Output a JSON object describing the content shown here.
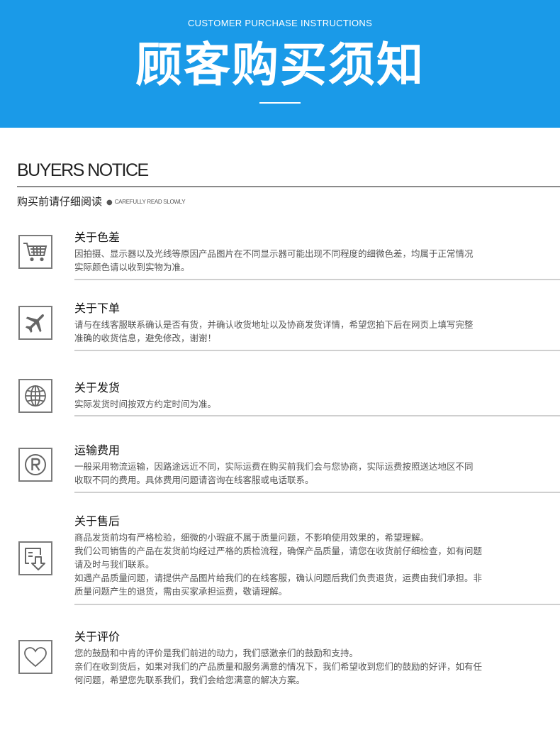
{
  "banner": {
    "title_en": "CUSTOMER PURCHASE INSTRUCTIONS",
    "title_cn": "顾客购买须知"
  },
  "notice": {
    "title": "BUYERS NOTICE",
    "subtitle_cn": "购买前请仔细阅读",
    "subtitle_dot": "●",
    "subtitle_en": "CAREFULLY READ SLOWLY"
  },
  "sections": [
    {
      "icon": "shopping-cart-icon",
      "title": "关于色差",
      "lines": [
        "因拍摄、显示器以及光线等原因产品图片在不同显示器可能出现不同程度的细微色差，均属于正常情况",
        "实际颜色请以收到实物为准。"
      ]
    },
    {
      "icon": "airplane-icon",
      "title": "关于下单",
      "lines": [
        "请与在线客服联系确认是否有货，并确认收货地址以及协商发货详情，希望您拍下后在网页上填写完整",
        "准确的收货信息，避免修改，谢谢！"
      ]
    },
    {
      "icon": "globe-icon",
      "title": "关于发货",
      "lines": [
        "实际发货时间按双方约定时间为准。"
      ]
    },
    {
      "icon": "registered-icon",
      "title": "运输费用",
      "lines": [
        "一般采用物流运输，因路途远近不同，实际运费在购买前我们会与您协商，实际运费按照送达地区不同",
        "收取不同的费用。具体费用问题请咨询在线客服或电话联系。"
      ]
    },
    {
      "icon": "return-download-icon",
      "title": "关于售后",
      "lines": [
        "商品发货前均有严格检验，细微的小瑕疵不属于质量问题，不影响使用效果的，希望理解。",
        "我们公司销售的产品在发货前均经过严格的质检流程，确保产品质量，请您在收货前仔细检查，如有问题",
        "请及时与我们联系。",
        "如遇产品质量问题，请提供产品图片给我们的在线客服，确认问题后我们负责退货，运费由我们承担。非",
        "质量问题产生的退货，需由买家承担运费，敬请理解。"
      ]
    },
    {
      "icon": "heart-icon",
      "title": "关于评价",
      "lines": [
        "您的鼓励和中肯的评价是我们前进的动力，我们感激亲们的鼓励和支持。",
        "亲们在收到货后，如果对我们的产品质量和服务满意的情况下，我们希望收到您们的鼓励的好评，如有任",
        "何问题，希望您先联系我们，我们会给您满意的解决方案。"
      ]
    }
  ]
}
